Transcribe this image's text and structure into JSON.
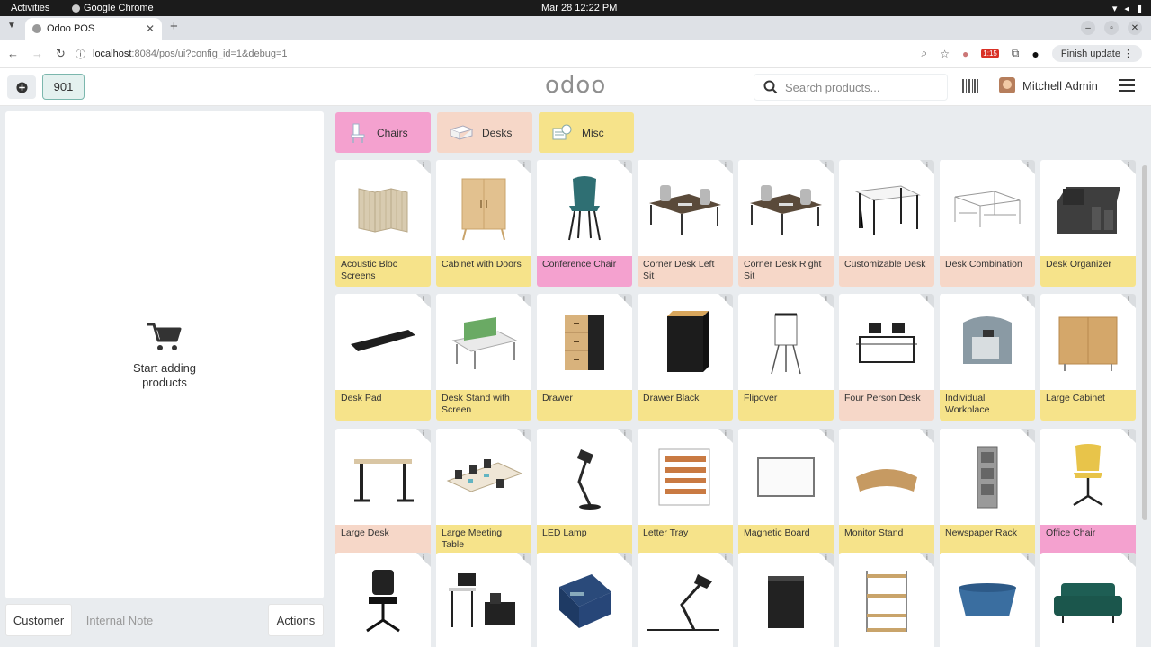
{
  "os": {
    "activities": "Activities",
    "app_name": "Google Chrome",
    "datetime": "Mar 28  12:22 PM"
  },
  "browser": {
    "tab_title": "Odoo POS",
    "url_host": "localhost",
    "url_path": ":8084/pos/ui?config_id=1&debug=1",
    "ext_badge": "1:15",
    "finish_update": "Finish update"
  },
  "header": {
    "order_number": "901",
    "logo": "odoo",
    "search_placeholder": "Search products...",
    "user_name": "Mitchell Admin"
  },
  "order": {
    "empty_text": "Start adding products"
  },
  "actions": {
    "customer": "Customer",
    "internal_note": "Internal Note",
    "actions": "Actions"
  },
  "categories": [
    {
      "label": "Chairs",
      "color": "#f4a1cf"
    },
    {
      "label": "Desks",
      "color": "#f6d7c8"
    },
    {
      "label": "Misc",
      "color": "#f6e38a"
    }
  ],
  "products": [
    {
      "name": "Acoustic Bloc Screens",
      "color": "yellow",
      "icon": "acoustic-screen-icon"
    },
    {
      "name": "Cabinet with Doors",
      "color": "yellow",
      "icon": "cabinet-icon"
    },
    {
      "name": "Conference Chair",
      "color": "pink",
      "icon": "chair-icon"
    },
    {
      "name": "Corner Desk Left Sit",
      "color": "peach",
      "icon": "corner-desk-icon"
    },
    {
      "name": "Corner Desk Right Sit",
      "color": "peach",
      "icon": "corner-desk-icon"
    },
    {
      "name": "Customizable Desk",
      "color": "peach",
      "icon": "desk-icon"
    },
    {
      "name": "Desk Combination",
      "color": "peach",
      "icon": "desk-combination-icon"
    },
    {
      "name": "Desk Organizer",
      "color": "yellow",
      "icon": "organizer-icon"
    },
    {
      "name": "Desk Pad",
      "color": "yellow",
      "icon": "desk-pad-icon"
    },
    {
      "name": "Desk Stand with Screen",
      "color": "yellow",
      "icon": "desk-stand-icon"
    },
    {
      "name": "Drawer",
      "color": "yellow",
      "icon": "drawer-icon"
    },
    {
      "name": "Drawer Black",
      "color": "yellow",
      "icon": "drawer-black-icon"
    },
    {
      "name": "Flipover",
      "color": "yellow",
      "icon": "flipover-icon"
    },
    {
      "name": "Four Person Desk",
      "color": "peach",
      "icon": "four-person-desk-icon"
    },
    {
      "name": "Individual Workplace",
      "color": "yellow",
      "icon": "workplace-icon"
    },
    {
      "name": "Large Cabinet",
      "color": "yellow",
      "icon": "large-cabinet-icon"
    },
    {
      "name": "Large Desk",
      "color": "peach",
      "icon": "large-desk-icon"
    },
    {
      "name": "Large Meeting Table",
      "color": "yellow",
      "icon": "meeting-table-icon"
    },
    {
      "name": "LED Lamp",
      "color": "yellow",
      "icon": "lamp-icon"
    },
    {
      "name": "Letter Tray",
      "color": "yellow",
      "icon": "letter-tray-icon"
    },
    {
      "name": "Magnetic Board",
      "color": "yellow",
      "icon": "board-icon"
    },
    {
      "name": "Monitor Stand",
      "color": "yellow",
      "icon": "monitor-stand-icon"
    },
    {
      "name": "Newspaper Rack",
      "color": "yellow",
      "icon": "newspaper-rack-icon"
    },
    {
      "name": "Office Chair",
      "color": "pink",
      "icon": "office-chair-icon"
    },
    {
      "name": "",
      "color": "pink",
      "icon": "office-chair-black-icon"
    },
    {
      "name": "",
      "color": "yellow",
      "icon": "desk-set-icon"
    },
    {
      "name": "",
      "color": "yellow",
      "icon": "box-icon"
    },
    {
      "name": "",
      "color": "yellow",
      "icon": "desk-lamp-icon"
    },
    {
      "name": "",
      "color": "yellow",
      "icon": "bin-icon"
    },
    {
      "name": "",
      "color": "yellow",
      "icon": "shelf-icon"
    },
    {
      "name": "",
      "color": "yellow",
      "icon": "basket-icon"
    },
    {
      "name": "",
      "color": "yellow",
      "icon": "sofa-icon"
    }
  ]
}
